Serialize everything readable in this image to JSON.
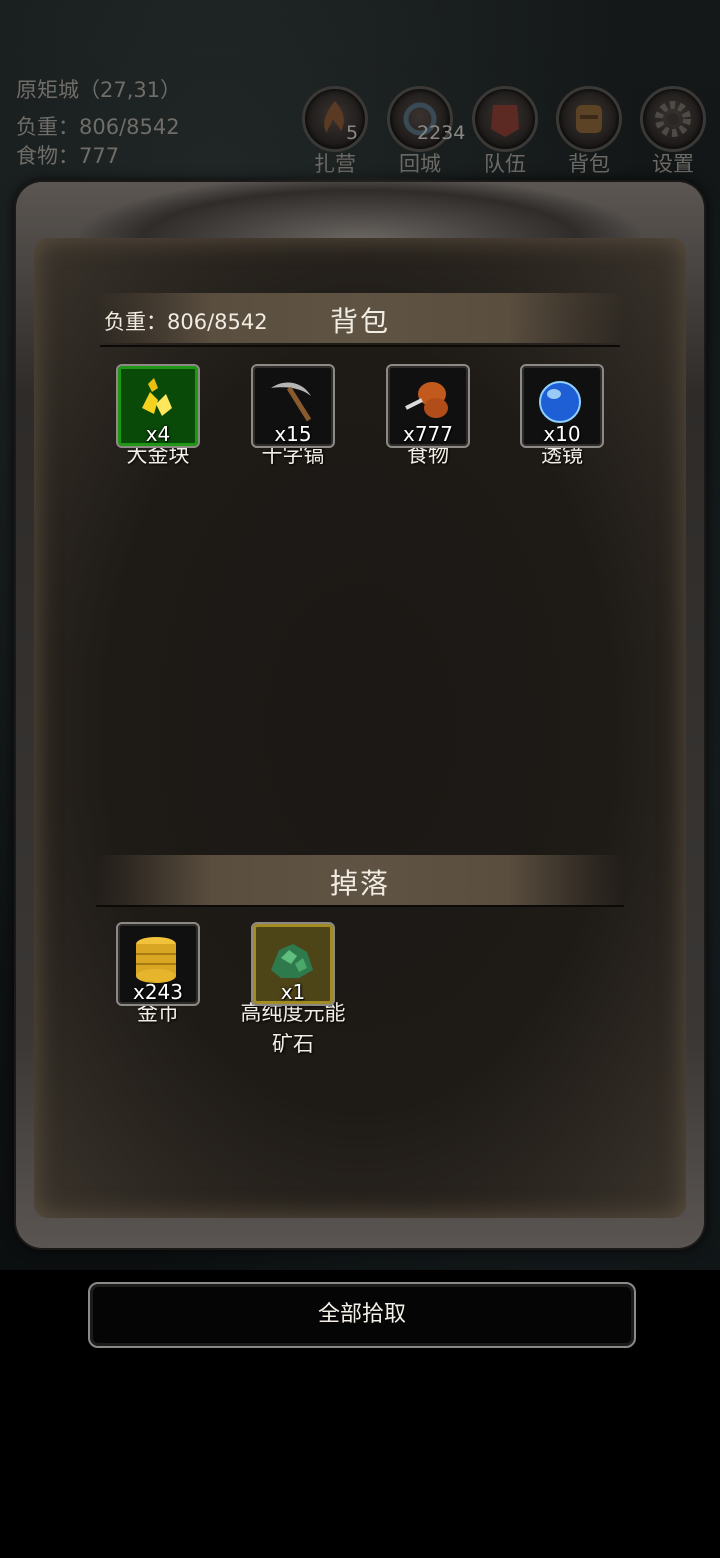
{
  "hud": {
    "location": "原矩城（27,31）",
    "weight": "负重：806/8542",
    "food": "食物：777",
    "buttons": [
      {
        "label": "扎营",
        "badge": "5",
        "icon": "campfire-icon"
      },
      {
        "label": "回城",
        "badge": "2234",
        "icon": "portal-icon"
      },
      {
        "label": "队伍",
        "badge": "",
        "icon": "team-icon"
      },
      {
        "label": "背包",
        "badge": "",
        "icon": "backpack-icon"
      },
      {
        "label": "设置",
        "badge": "",
        "icon": "gear-icon"
      }
    ]
  },
  "backpack": {
    "title": "背包",
    "weight": "负重：806/8542",
    "items": [
      {
        "name": "大金块",
        "qty": "x4",
        "icon": "gold-nugget-icon",
        "frame": "green"
      },
      {
        "name": "十字镐",
        "qty": "x15",
        "icon": "pickaxe-icon",
        "frame": "normal"
      },
      {
        "name": "食物",
        "qty": "x777",
        "icon": "meat-drumstick-icon",
        "frame": "normal"
      },
      {
        "name": "透镜",
        "qty": "x10",
        "icon": "blue-orb-icon",
        "frame": "normal"
      }
    ]
  },
  "drops": {
    "title": "掉落",
    "items": [
      {
        "name": "金币",
        "qty": "x243",
        "icon": "gold-coins-icon",
        "frame": "normal"
      },
      {
        "name": "高纯度元能矿石",
        "name_line1": "高纯度元能",
        "name_line2": "矿石",
        "qty": "x1",
        "icon": "green-ore-icon",
        "frame": "gold"
      }
    ]
  },
  "actions": {
    "pickup_all": "全部拾取"
  }
}
